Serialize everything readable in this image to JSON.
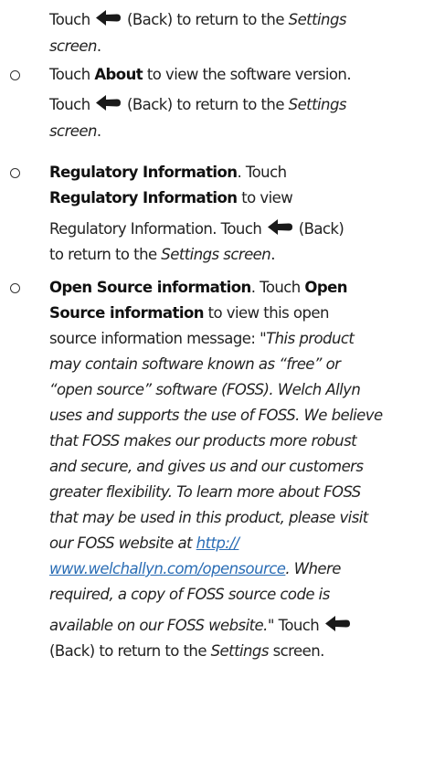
{
  "colors": {
    "text": "#222222",
    "link": "#2a6db5",
    "arrow": "#1a1a1a"
  },
  "icons": {
    "back": "left-arrow-icon"
  },
  "lines": {
    "l1a": "Touch",
    "l1b": "(Back) to return to the",
    "l1c": "Settings",
    "l2": "screen",
    "l2b": ".",
    "l3a": "Touch",
    "l3b": "About",
    "l3c": "to view the software version.",
    "l4a": "Touch",
    "l4b": "(Back) to return to the",
    "l4c": "Settings",
    "l5": "screen",
    "l5b": ".",
    "l6a": "Regulatory Information",
    "l6b": ". Touch",
    "l7": "Regulatory Information",
    "l7b": "to view",
    "l8a": "Regulatory Information. Touch",
    "l8b": "(Back)",
    "l9a": "to return to the",
    "l9b": "Settings screen",
    "l9c": ".",
    "l10a": "Open Source information",
    "l10b": ". Touch",
    "l10c": "Open",
    "l11a": "Source information",
    "l11b": "to view this open",
    "l12a": "source information message: \"",
    "l12b": "This product",
    "l13": "may contain software known as “free” or",
    "l14": "“open source” software (FOSS). Welch Allyn",
    "l15": "uses and supports the use of FOSS. We believe",
    "l16": "that FOSS makes our products more robust",
    "l17": "and secure, and gives us and our customers",
    "l18": "greater flexibility. To learn more about FOSS",
    "l19": "that may be used in this product, please visit",
    "l20a": "our FOSS website at",
    "l20b": "http://",
    "l21a": "www.welchallyn.com/opensource",
    "l21b": ". Where",
    "l22": "required, a copy of FOSS source code is",
    "l23a": "available on our FOSS website.",
    "l23b": "\" Touch",
    "l24a": "(Back) to return to the",
    "l24b": "Settings",
    "l24c": "screen."
  }
}
